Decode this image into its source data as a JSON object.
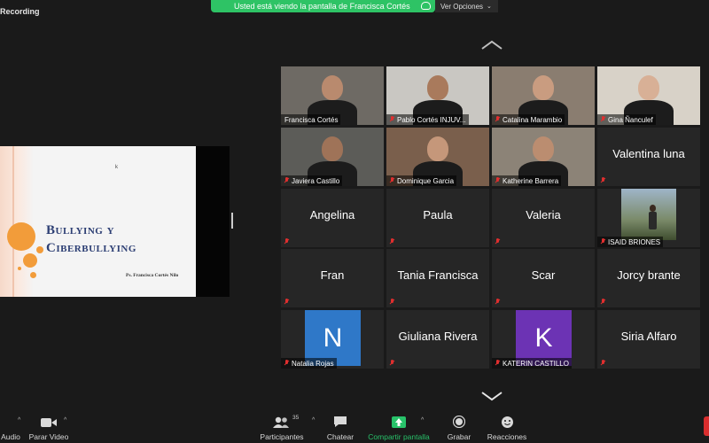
{
  "recording": {
    "label": "Recording"
  },
  "share_banner": {
    "text": "Usted está viendo la pantalla de Francisca Cortés"
  },
  "view_options": {
    "label": "Ver Opciones"
  },
  "slide": {
    "title_line1": "Bullying y",
    "title_line2": "Ciberbullying",
    "author": "Ps. Francisca Cortés Nilo",
    "cursor": "k"
  },
  "participants": [
    {
      "name": "Francisca Cortés",
      "muted": false,
      "video": true,
      "active": true
    },
    {
      "name": "Pablo Cortés INJUV...",
      "muted": true,
      "video": true
    },
    {
      "name": "Catalina Marambio",
      "muted": true,
      "video": true
    },
    {
      "name": "Gina Ñanculef",
      "muted": true,
      "video": true
    },
    {
      "name": "Javiera Castillo",
      "muted": true,
      "video": true
    },
    {
      "name": "Dominique Garcia",
      "muted": true,
      "video": true
    },
    {
      "name": "Katherine Barrera",
      "muted": true,
      "video": true
    },
    {
      "name": "Valentina luna",
      "muted": true,
      "video": false
    },
    {
      "name": "Angelina",
      "muted": true,
      "video": false
    },
    {
      "name": "Paula",
      "muted": true,
      "video": false
    },
    {
      "name": "Valeria",
      "muted": true,
      "video": false
    },
    {
      "name": "ISAID BRIONES",
      "muted": true,
      "video": true
    },
    {
      "name": "Fran",
      "muted": true,
      "video": false
    },
    {
      "name": "Tania Francisca",
      "muted": true,
      "video": false
    },
    {
      "name": "Scar",
      "muted": true,
      "video": false
    },
    {
      "name": "Jorcy brante",
      "muted": true,
      "video": false
    },
    {
      "name": "Natalia Rojas",
      "muted": true,
      "video": false,
      "avatar": "N",
      "avatar_color": "#2f78c8"
    },
    {
      "name": "Giuliana Rivera",
      "muted": true,
      "video": false
    },
    {
      "name": "KATERIN CASTILLO",
      "muted": true,
      "video": false,
      "avatar": "K",
      "avatar_color": "#6c33b4"
    },
    {
      "name": "Siria Alfaro",
      "muted": true,
      "video": false
    }
  ],
  "toolbar": {
    "audio": "Audio",
    "stop_video": "Parar Video",
    "participants": "Participantes",
    "participants_count": "35",
    "chat": "Chatear",
    "share": "Compartir pantalla",
    "record": "Grabar",
    "reactions": "Reacciones"
  },
  "colors": {
    "accent_green": "#2ec365",
    "active_border": "#c4e87a",
    "muted_red": "#e02f2f"
  }
}
